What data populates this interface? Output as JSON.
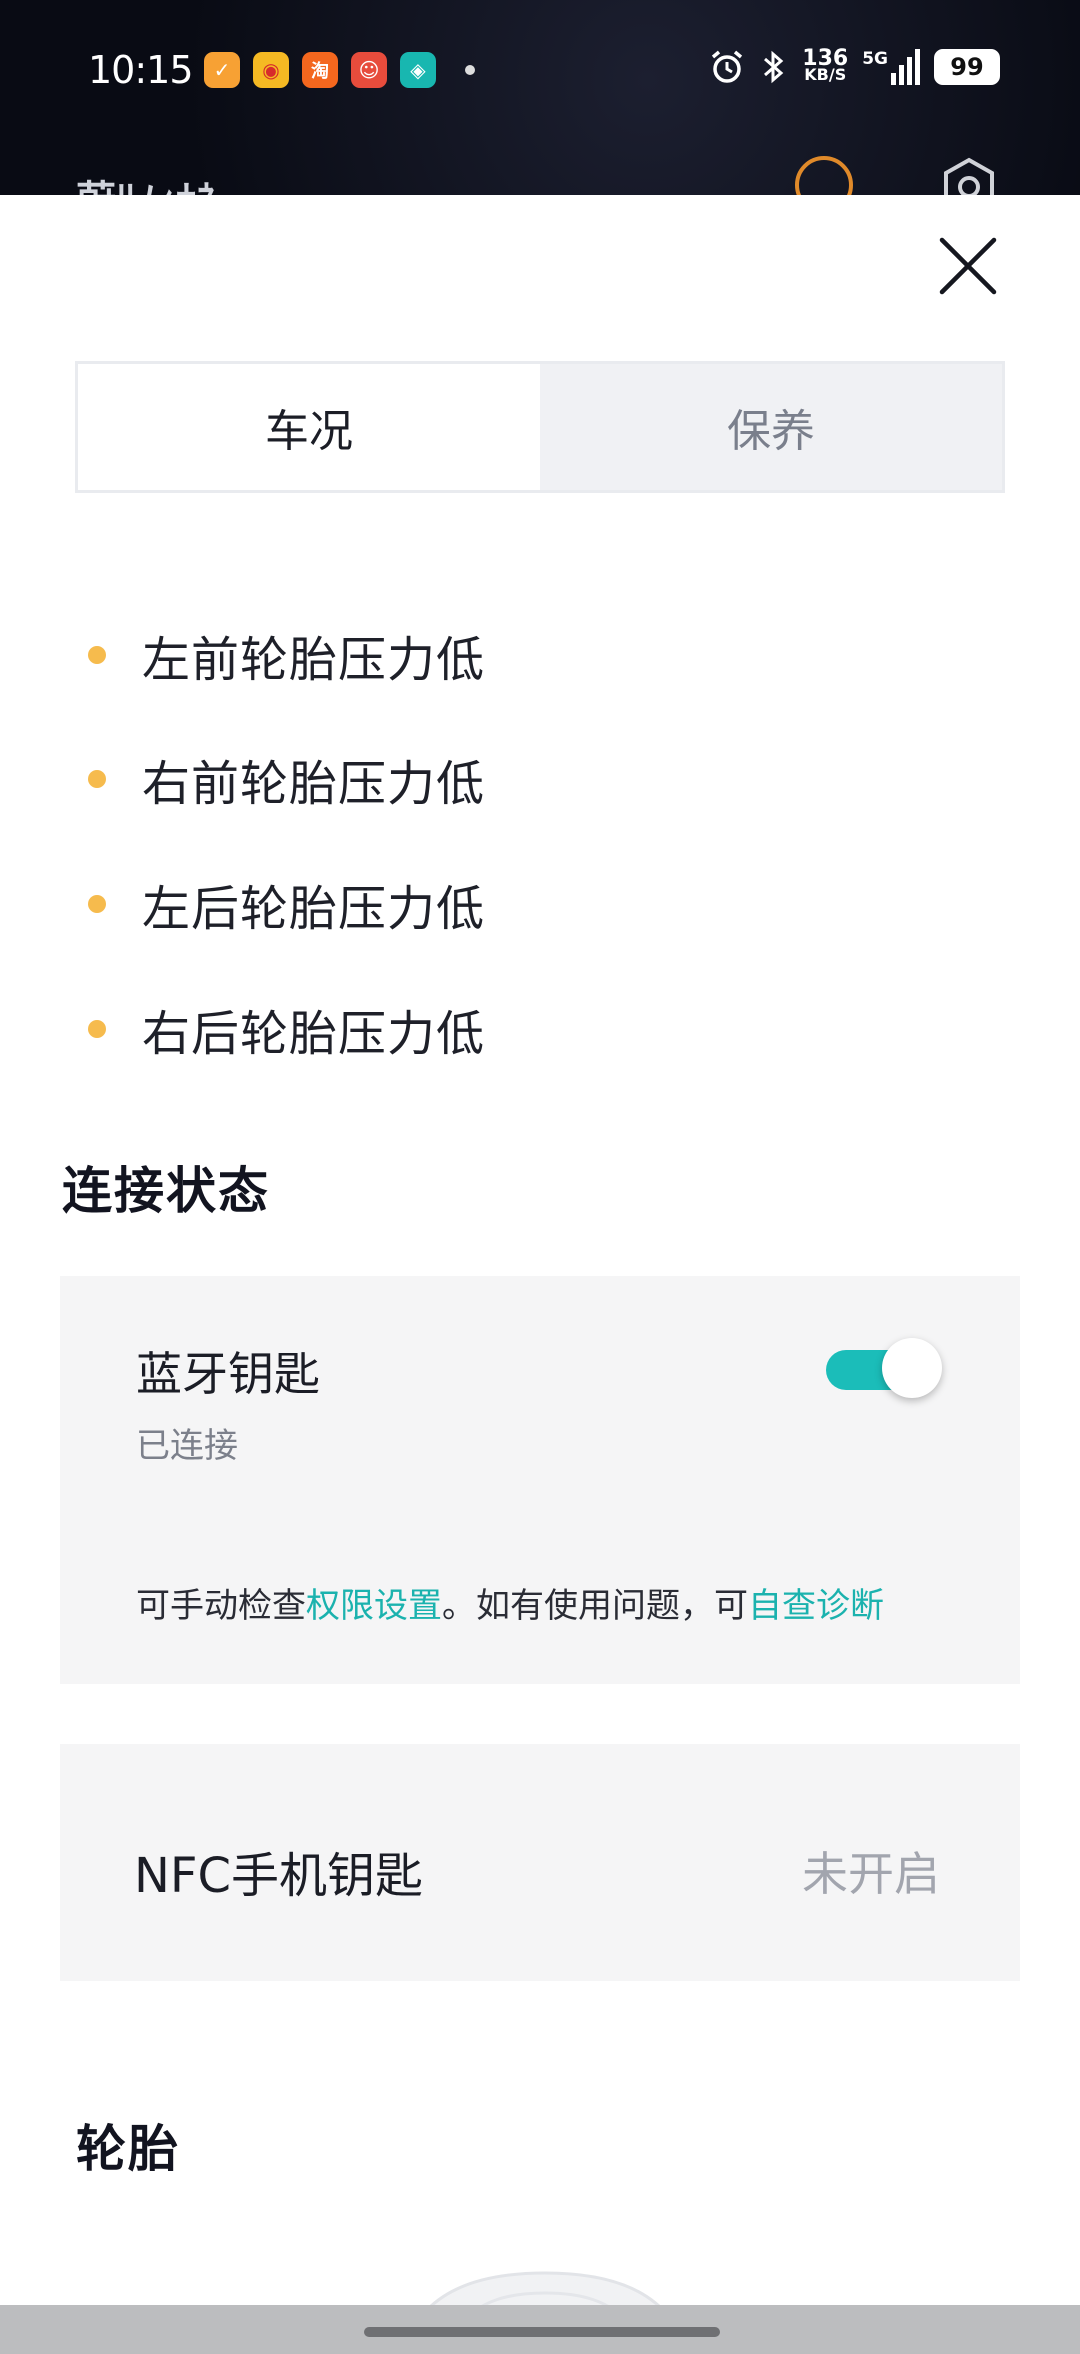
{
  "status_bar": {
    "time": "10:15",
    "apps": [
      {
        "icon": "app-icon-1",
        "glyph": "✓",
        "color": "#f7a134"
      },
      {
        "icon": "weibo-icon",
        "glyph": "◉",
        "color": "#f5a623"
      },
      {
        "icon": "taobao-icon",
        "glyph": "淘",
        "color": "#f4671e"
      },
      {
        "icon": "app-icon-4",
        "glyph": "☺",
        "color": "#e74c3c"
      },
      {
        "icon": "app-icon-5",
        "glyph": "◈",
        "color": "#18b7b0"
      }
    ],
    "network_speed_value": "136",
    "network_speed_unit": "KB/S",
    "network_type": "5G",
    "battery": "99"
  },
  "behind_header": {
    "title": "蔚ﾘﾉｨﾅﾈ"
  },
  "tabs": [
    {
      "label": "车况",
      "active": true
    },
    {
      "label": "保养",
      "active": false
    }
  ],
  "alerts": [
    "左前轮胎压力低",
    "右前轮胎压力低",
    "左后轮胎压力低",
    "右后轮胎压力低"
  ],
  "connection": {
    "section_title": "连接状态",
    "bluetooth_key": {
      "title": "蓝牙钥匙",
      "status": "已连接",
      "toggle_on": true,
      "hint_prefix": "可手动检查",
      "hint_link1": "权限设置",
      "hint_middle": "。如有使用问题，可",
      "hint_link2": "自查诊断"
    },
    "nfc_key": {
      "label": "NFC手机钥匙",
      "value": "未开启"
    }
  },
  "tires": {
    "section_title": "轮胎"
  },
  "colors": {
    "accent": "#1bbdb9",
    "warning_dot": "#f6bb4d"
  }
}
